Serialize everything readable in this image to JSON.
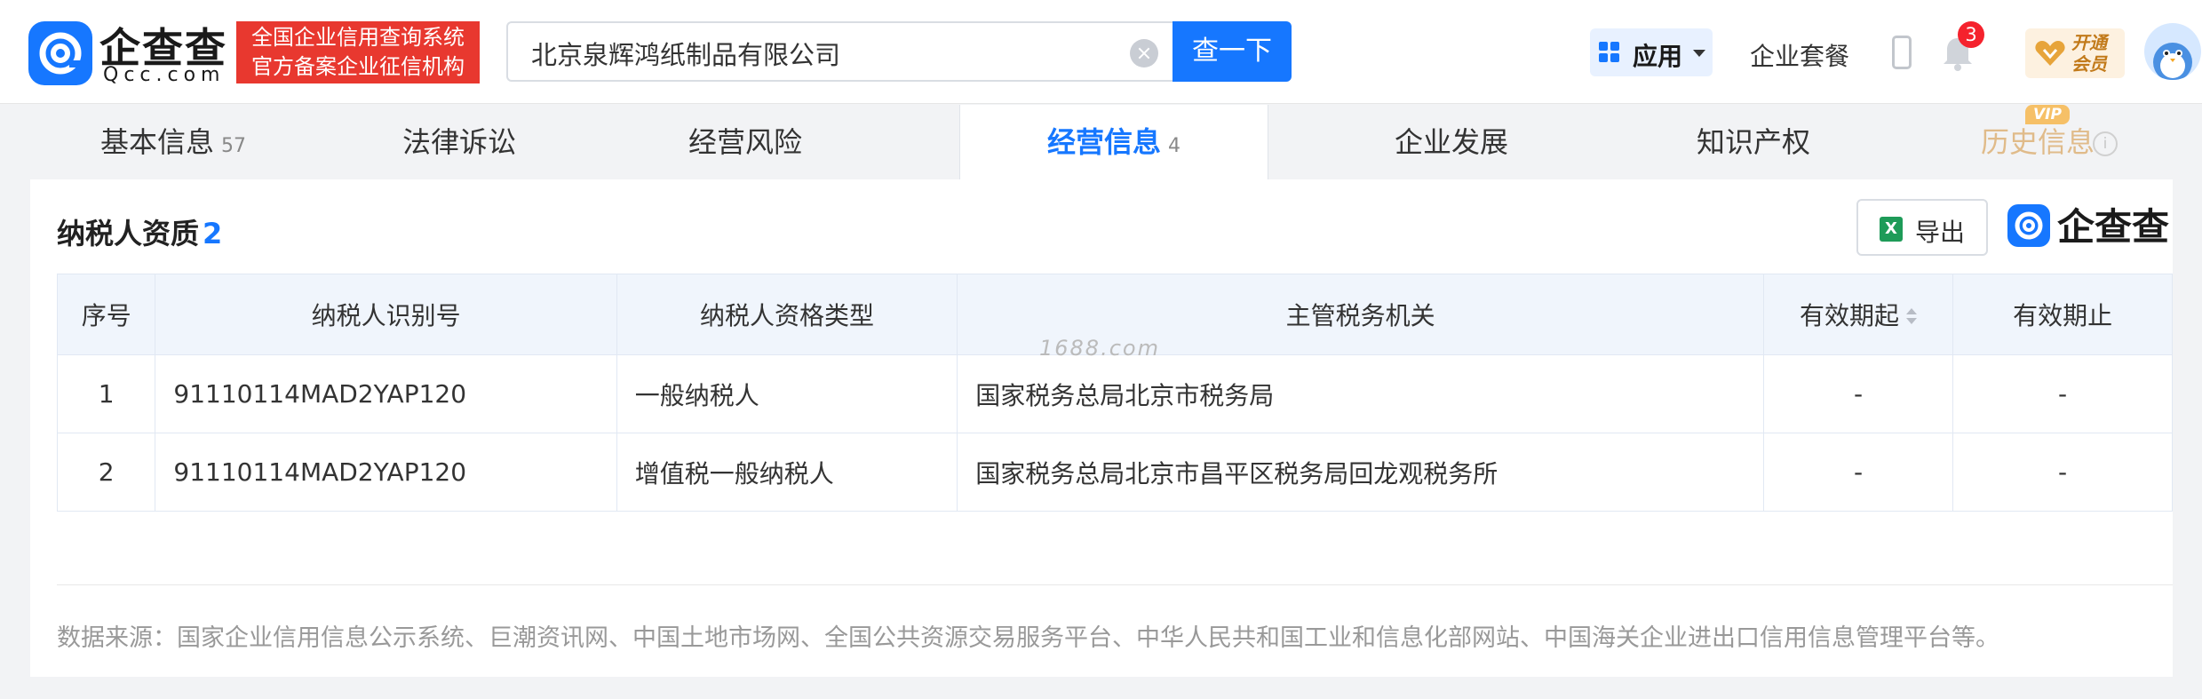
{
  "header": {
    "logo_text": "企查查",
    "logo_sub": "Qcc.com",
    "slogan_line1": "全国企业信用查询系统",
    "slogan_line2": "官方备案企业征信机构",
    "search_value": "北京泉辉鸿纸制品有限公司",
    "search_button": "查一下",
    "app_label": "应用",
    "package_label": "企业套餐",
    "notification_count": "3",
    "vip_line1": "开通",
    "vip_line2": "会员"
  },
  "tabs": [
    {
      "label": "基本信息",
      "count": "57"
    },
    {
      "label": "法律诉讼",
      "count": ""
    },
    {
      "label": "经营风险",
      "count": ""
    },
    {
      "label": "经营信息",
      "count": "4"
    },
    {
      "label": "企业发展",
      "count": ""
    },
    {
      "label": "知识产权",
      "count": ""
    },
    {
      "label": "历史信息",
      "count": ""
    }
  ],
  "vip_tag": "VIP",
  "section": {
    "title": "纳税人资质",
    "count": "2",
    "export_label": "导出",
    "brand_text": "企查查"
  },
  "table": {
    "headers": [
      "序号",
      "纳税人识别号",
      "纳税人资格类型",
      "主管税务机关",
      "有效期起",
      "有效期止"
    ],
    "rows": [
      [
        "1",
        "91110114MAD2YAP120",
        "一般纳税人",
        "国家税务总局北京市税务局",
        "-",
        "-"
      ],
      [
        "2",
        "91110114MAD2YAP120",
        "增值税一般纳税人",
        "国家税务总局北京市昌平区税务局回龙观税务所",
        "-",
        "-"
      ]
    ]
  },
  "watermark": "1688.com",
  "source_note": "数据来源：国家企业信用信息公示系统、巨潮资讯网、中国土地市场网、全国公共资源交易服务平台、中华人民共和国工业和信息化部网站、中国海关企业进出口信用信息管理平台等。",
  "colors": {
    "accent": "#1677ff",
    "slogan_bg": "#e8382f",
    "badge": "#f5222d",
    "vip": "#f6c067"
  }
}
